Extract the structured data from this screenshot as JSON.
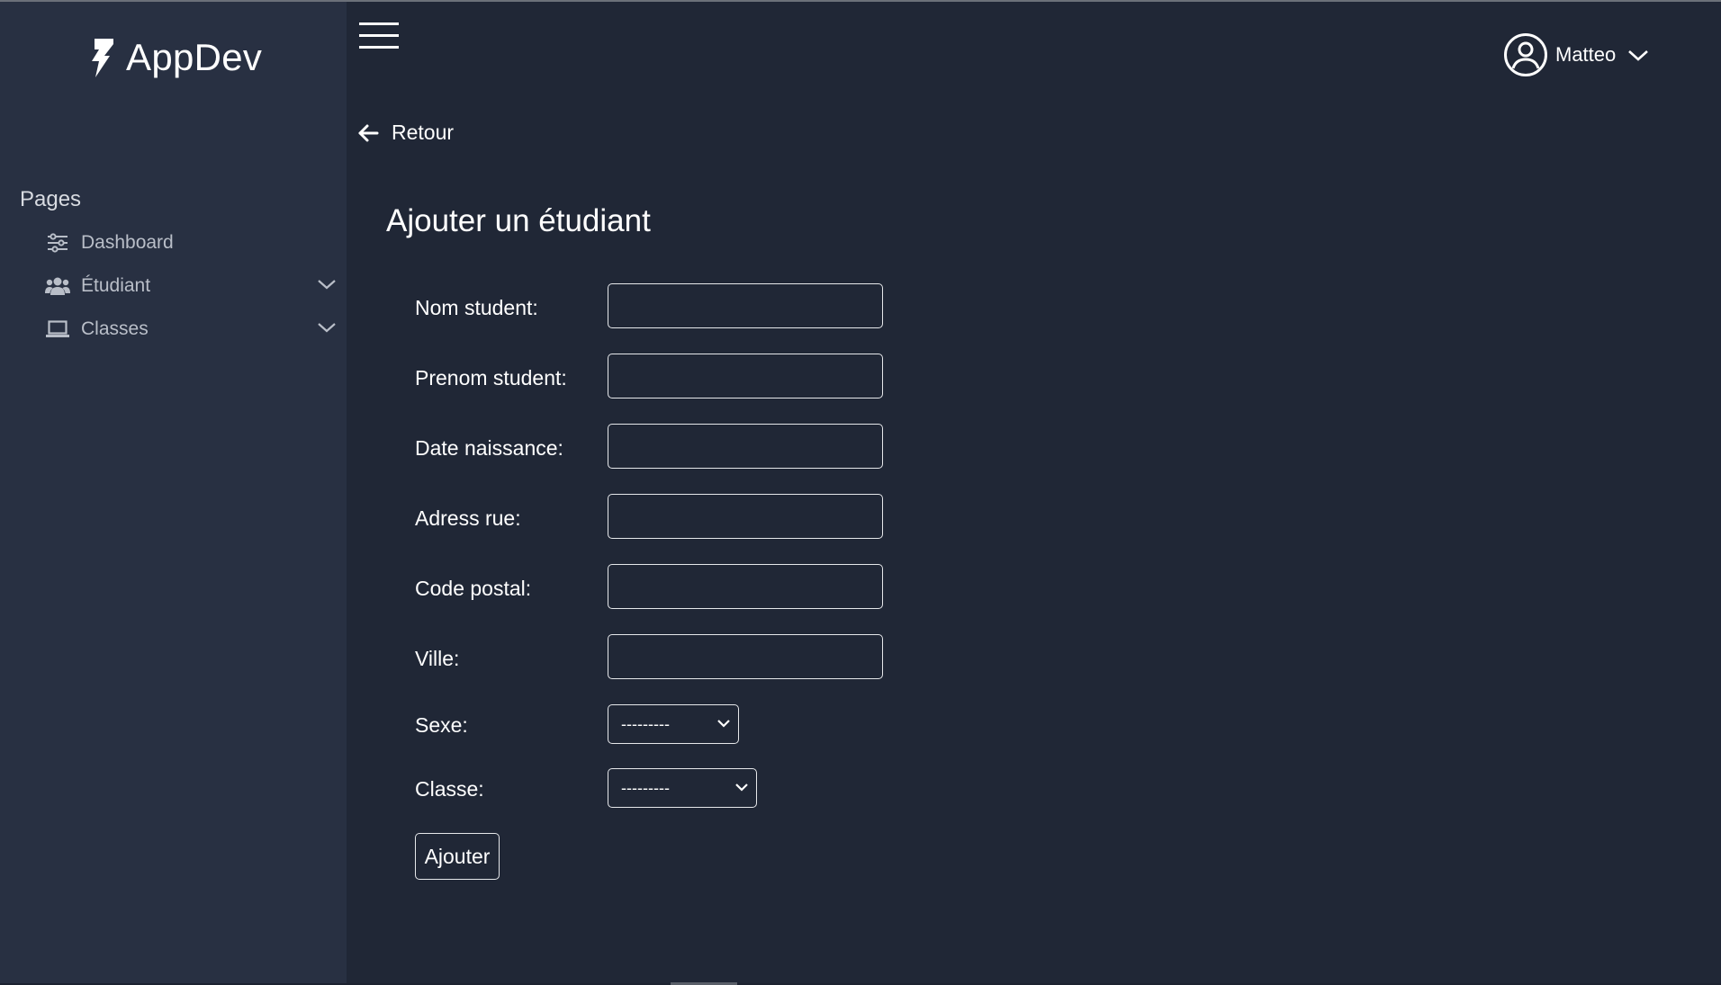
{
  "brand": {
    "name": "AppDev",
    "icon": "bolt-logo-icon"
  },
  "sidebar": {
    "heading": "Pages",
    "items": [
      {
        "label": "Dashboard",
        "icon": "sliders-icon",
        "has_submenu": false
      },
      {
        "label": "Étudiant",
        "icon": "users-icon",
        "has_submenu": true
      },
      {
        "label": "Classes",
        "icon": "laptop-icon",
        "has_submenu": true
      }
    ]
  },
  "topbar": {
    "menu_icon": "hamburger-icon",
    "user": {
      "name": "Matteo",
      "icon": "user-circle-icon"
    }
  },
  "back": {
    "label": "Retour",
    "icon": "arrow-left-icon"
  },
  "page": {
    "title": "Ajouter un étudiant"
  },
  "form": {
    "fields": [
      {
        "label": "Nom student:",
        "value": ""
      },
      {
        "label": "Prenom student:",
        "value": ""
      },
      {
        "label": "Date naissance:",
        "value": ""
      },
      {
        "label": "Adress rue:",
        "value": ""
      },
      {
        "label": "Code postal:",
        "value": ""
      },
      {
        "label": "Ville:",
        "value": ""
      }
    ],
    "selects": [
      {
        "label": "Sexe:",
        "selected": "---------"
      },
      {
        "label": "Classe:",
        "selected": "---------"
      }
    ],
    "submit_label": "Ajouter"
  },
  "colors": {
    "background": "#202736",
    "sidebar": "#283042",
    "text": "#ffffff",
    "muted_text": "#b9bec8",
    "border": "#e6e8eb"
  }
}
